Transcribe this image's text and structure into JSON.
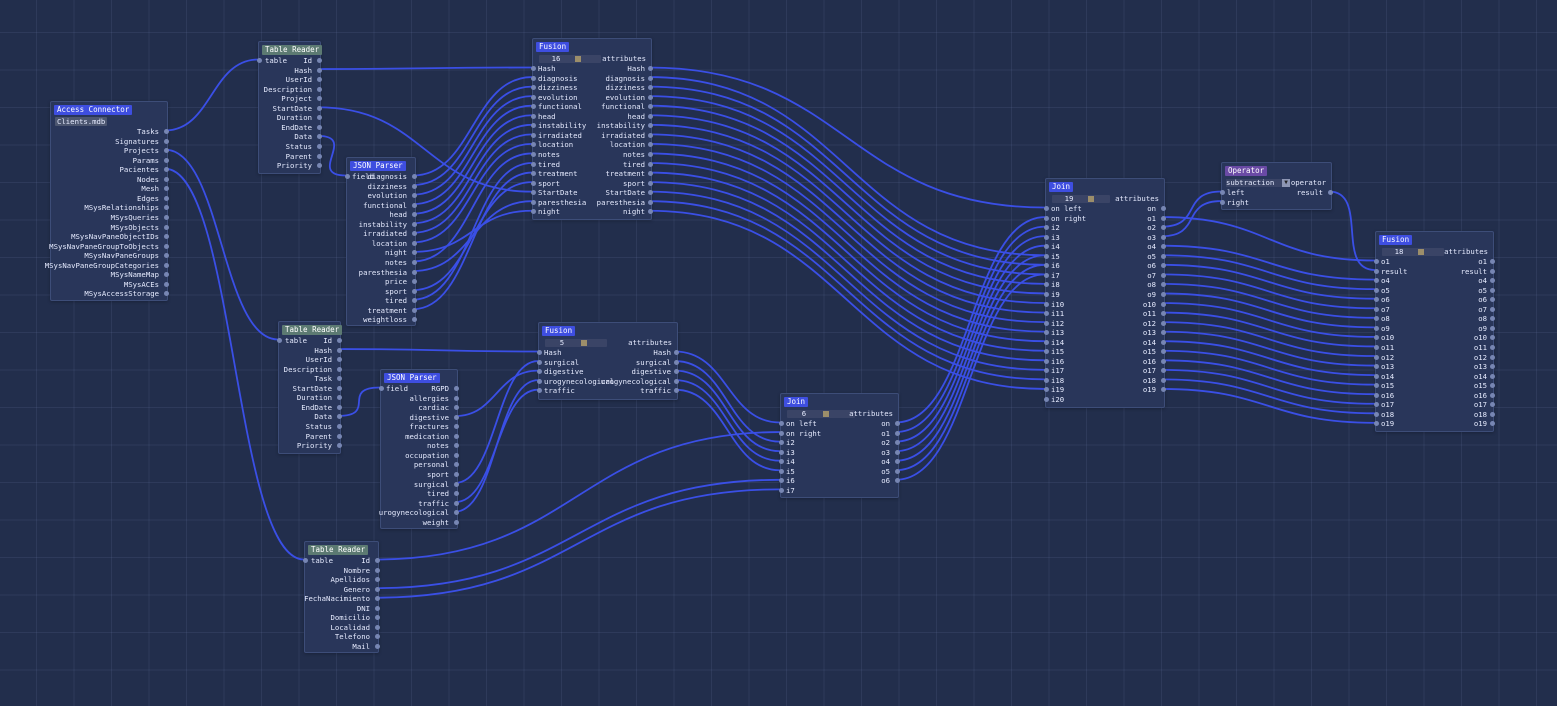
{
  "wire_color": "#3a4fe6",
  "nodes": {
    "access": {
      "title": "Access Connector",
      "file": "Clients.mdb",
      "outputs": [
        "Tasks",
        "Signatures",
        "Projects",
        "Params",
        "Pacientes",
        "Nodes",
        "Mesh",
        "Edges",
        "MSysRelationships",
        "MSysQueries",
        "MSysObjects",
        "MSysNavPaneObjectIDs",
        "MSysNavPaneGroupToObjects",
        "MSysNavPaneGroups",
        "MSysNavPaneGroupCategories",
        "MSysNameMap",
        "MSysACEs",
        "MSysAccessStorage"
      ]
    },
    "tr1": {
      "title": "Table Reader",
      "input": "table",
      "outputs": [
        "Id",
        "Hash",
        "UserId",
        "Description",
        "Project",
        "StartDate",
        "Duration",
        "EndDate",
        "Data",
        "Status",
        "Parent",
        "Priority"
      ]
    },
    "tr2": {
      "title": "Table Reader",
      "input": "table",
      "outputs": [
        "Id",
        "Hash",
        "UserId",
        "Description",
        "Task",
        "StartDate",
        "Duration",
        "EndDate",
        "Data",
        "Status",
        "Parent",
        "Priority"
      ]
    },
    "tr3": {
      "title": "Table Reader",
      "input": "table",
      "outputs": [
        "Id",
        "Nombre",
        "Apellidos",
        "Genero",
        "FechaNacimiento",
        "DNI",
        "Domicilio",
        "Localidad",
        "Telefono",
        "Mail"
      ]
    },
    "jp1": {
      "title": "JSON Parser",
      "input": "field",
      "outputs": [
        "diagnosis",
        "dizziness",
        "evolution",
        "functional",
        "head",
        "instability",
        "irradiated",
        "location",
        "night",
        "notes",
        "paresthesia",
        "price",
        "sport",
        "tired",
        "treatment",
        "weightloss"
      ]
    },
    "jp2": {
      "title": "JSON Parser",
      "input": "field",
      "outputs": [
        "RGPD",
        "allergies",
        "cardiac",
        "digestive",
        "fractures",
        "medication",
        "notes",
        "occupation",
        "personal",
        "sport",
        "surgical",
        "tired",
        "traffic",
        "urogynecological",
        "weight"
      ]
    },
    "fusion1": {
      "title": "Fusion",
      "count": "16",
      "attr_label": "attributes",
      "rows": [
        "Hash",
        "diagnosis",
        "dizziness",
        "evolution",
        "functional",
        "head",
        "instability",
        "irradiated",
        "location",
        "notes",
        "tired",
        "treatment",
        "sport",
        "StartDate",
        "paresthesia",
        "night"
      ]
    },
    "fusion2": {
      "title": "Fusion",
      "count": "5",
      "attr_label": "attributes",
      "rows": [
        "Hash",
        "surgical",
        "digestive",
        "urogynecological",
        "traffic"
      ]
    },
    "join1": {
      "title": "Join",
      "count": "19",
      "attr_label": "attributes",
      "inputs": [
        "on left",
        "on right",
        "i2",
        "i3",
        "i4",
        "i5",
        "i6",
        "i7",
        "i8",
        "i9",
        "i10",
        "i11",
        "i12",
        "i13",
        "i14",
        "i15",
        "i16",
        "i17",
        "i18",
        "i19",
        "i20"
      ],
      "outputs": [
        "on",
        "o1",
        "o2",
        "o3",
        "o4",
        "o5",
        "o6",
        "o7",
        "o8",
        "o9",
        "o10",
        "o11",
        "o12",
        "o13",
        "o14",
        "o15",
        "o16",
        "o17",
        "o18",
        "o19"
      ]
    },
    "join2": {
      "title": "Join",
      "count": "6",
      "attr_label": "attributes",
      "inputs": [
        "on left",
        "on right",
        "i2",
        "i3",
        "i4",
        "i5",
        "i6",
        "i7"
      ],
      "outputs": [
        "on",
        "o1",
        "o2",
        "o3",
        "o4",
        "o5",
        "o6"
      ]
    },
    "operator": {
      "title": "Operator",
      "op_value": "subtraction",
      "op_label": "operator",
      "inputs": [
        "left",
        "right"
      ],
      "output": "result"
    },
    "fusion3": {
      "title": "Fusion",
      "count": "18",
      "attr_label": "attributes",
      "rows": [
        "o1",
        "result",
        "o4",
        "o5",
        "o6",
        "o7",
        "o8",
        "o9",
        "o10",
        "o11",
        "o12",
        "o13",
        "o14",
        "o15",
        "o16",
        "o17",
        "o18",
        "o19"
      ]
    }
  }
}
